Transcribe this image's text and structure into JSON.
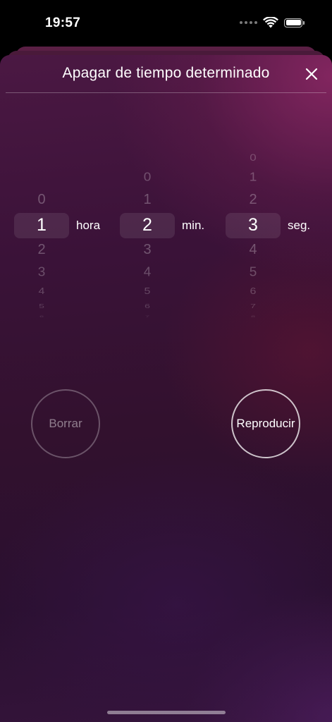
{
  "status_bar": {
    "time": "19:57",
    "icons": [
      "signal-dots-icon",
      "wifi-icon",
      "battery-icon"
    ],
    "battery_level": 1.0
  },
  "sheet": {
    "title": "Apagar de tiempo determinado",
    "close_icon": "close-icon"
  },
  "pickers": {
    "hours": {
      "above": [
        "0"
      ],
      "selected": "1",
      "below": [
        "2",
        "3",
        "4",
        "5",
        "6"
      ],
      "unit": "hora"
    },
    "minutes": {
      "above": [
        "0",
        "1"
      ],
      "selected": "2",
      "below": [
        "3",
        "4",
        "5",
        "6",
        "7"
      ],
      "unit": "min."
    },
    "seconds": {
      "above": [
        "0",
        "1",
        "2"
      ],
      "selected": "3",
      "below": [
        "4",
        "5",
        "6",
        "7",
        "8"
      ],
      "unit": "seg."
    }
  },
  "buttons": {
    "clear_label": "Borrar",
    "play_label": "Reproducir"
  },
  "colors": {
    "sheet_top": "#4b1843",
    "sheet_bottom": "#2a1030",
    "accent_glow": "#8c2864"
  }
}
